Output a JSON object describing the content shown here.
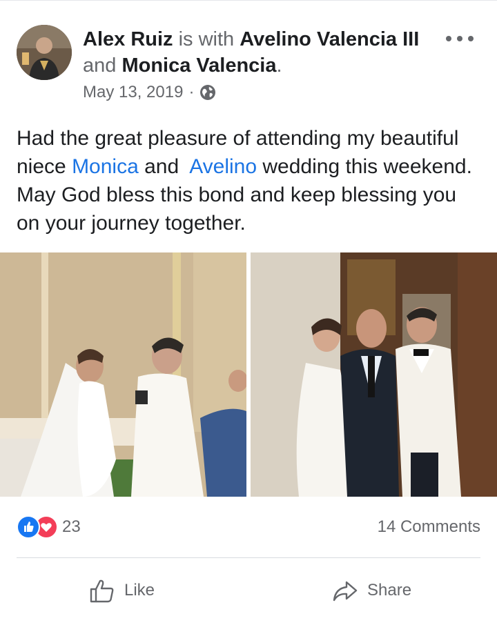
{
  "post": {
    "author": "Alex Ruiz",
    "with_text": "is with",
    "tagged_1": "Avelino Valencia III",
    "and_text": "and",
    "tagged_2": "Monica Valencia",
    "period": ".",
    "date": "May 13, 2019",
    "separator": "·",
    "privacy_icon": "globe-icon",
    "body": {
      "part1": "Had the great pleasure of attending my beautiful niece ",
      "mention1": "Monica",
      "part2": " and  ",
      "mention2": "Avelino",
      "part3": " wedding this weekend. May God bless this bond and keep blessing you on your journey together."
    },
    "photos": [
      "wedding-ceremony-photo",
      "wedding-group-photo"
    ]
  },
  "stats": {
    "reaction_icons": [
      "like-reaction-icon",
      "love-reaction-icon"
    ],
    "reaction_count": "23",
    "comments": "14 Comments"
  },
  "actions": {
    "like_label": "Like",
    "share_label": "Share"
  },
  "colors": {
    "link": "#1b74e4",
    "secondary_text": "#65676b",
    "like_blue": "#1877f2",
    "love_red": "#f33e58"
  }
}
